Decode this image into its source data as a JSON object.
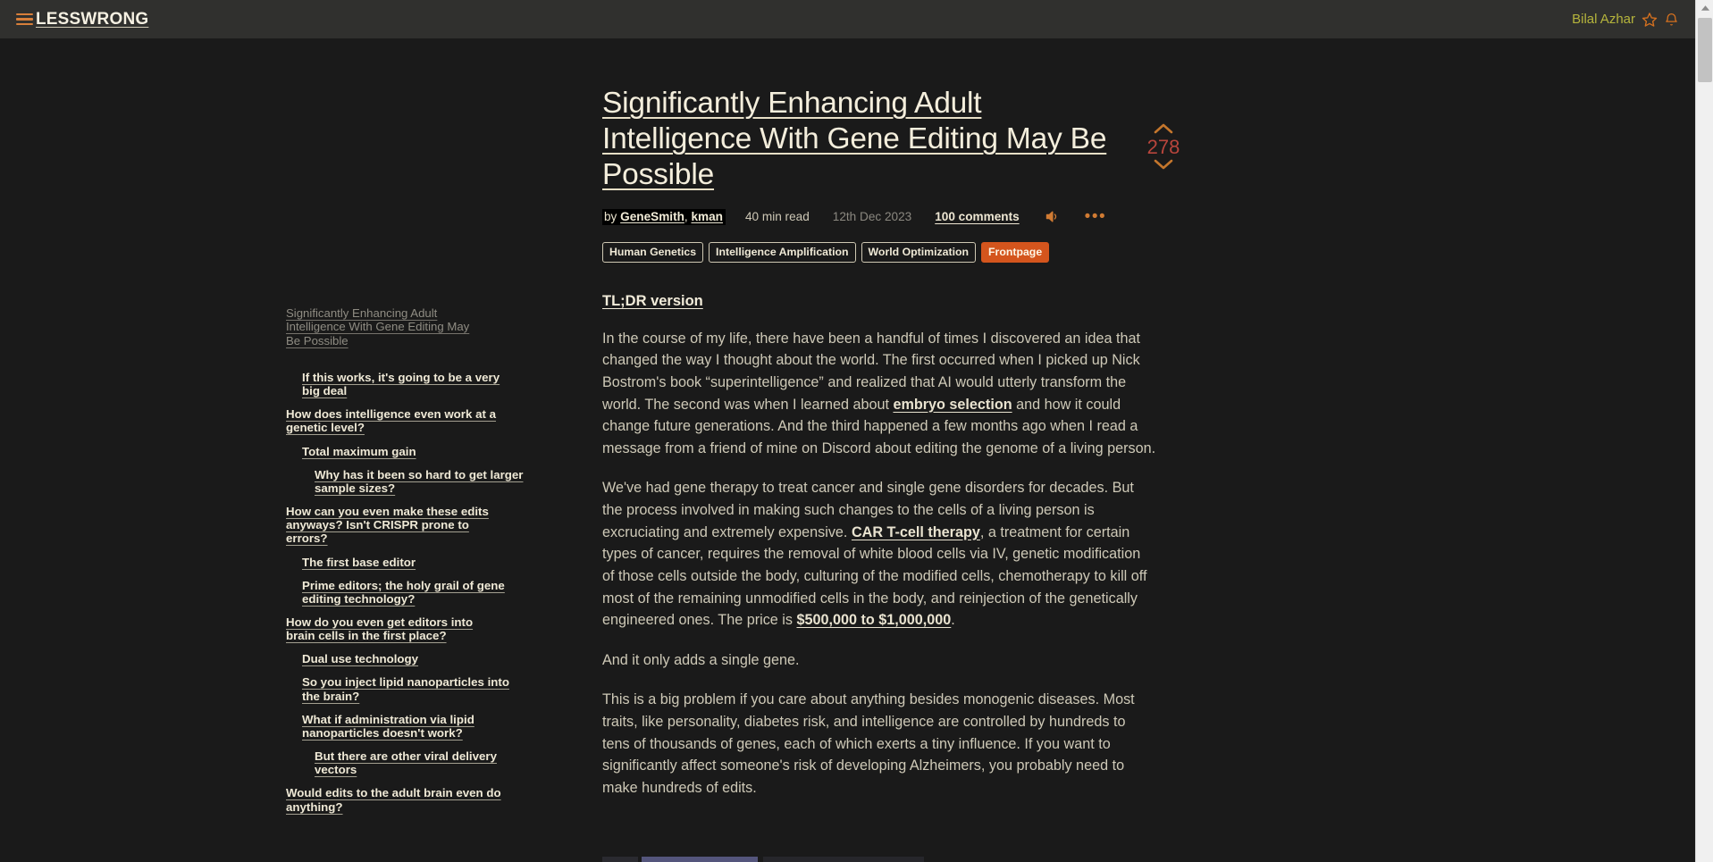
{
  "header": {
    "menu_icon": "hamburger-icon",
    "brand": "LESSWRONG",
    "username": "Bilal Azhar",
    "star_icon": "star-icon",
    "bell_icon": "bell-icon"
  },
  "sidebar": {
    "title_entry": "Significantly Enhancing Adult Intelligence With Gene Editing May Be Possible",
    "items": [
      {
        "label": "If this works, it's going to be a very big deal",
        "level": 1
      },
      {
        "label": "How does intelligence even work at a genetic level?",
        "level": 0
      },
      {
        "label": "Total maximum gain",
        "level": 1
      },
      {
        "label": "Why has it been so hard to get larger sample sizes?",
        "level": 2
      },
      {
        "label": "How can you even make these edits anyways? Isn't CRISPR prone to errors?",
        "level": 0
      },
      {
        "label": "The first base editor",
        "level": 1
      },
      {
        "label": "Prime editors; the holy grail of gene editing technology?",
        "level": 1
      },
      {
        "label": "How do you even get editors into brain cells in the first place?",
        "level": 0
      },
      {
        "label": "Dual use technology",
        "level": 1
      },
      {
        "label": "So you inject lipid nanoparticles into the brain?",
        "level": 1
      },
      {
        "label": "What if administration via lipid nanoparticles doesn't work?",
        "level": 1
      },
      {
        "label": "But there are other viral delivery vectors",
        "level": 2
      },
      {
        "label": "Would edits to the adult brain even do anything?",
        "level": 0
      }
    ]
  },
  "post": {
    "title": "Significantly Enhancing Adult Intelligence With Gene Editing May Be Possible",
    "vote": {
      "upvote_icon": "chevron-up-icon",
      "count": "278",
      "downvote_icon": "chevron-down-icon"
    },
    "byline": {
      "by_prefix": "by ",
      "author_1": "GeneSmith",
      "author_separator": ", ",
      "author_2": "kman",
      "read_time": "40 min read",
      "date": "12th Dec 2023",
      "comments": "100 comments",
      "audio_icon": "speaker-icon",
      "more_icon": "ellipsis-icon"
    },
    "tags": [
      {
        "label": "Human Genetics",
        "highlighted": false
      },
      {
        "label": "Intelligence Amplification",
        "highlighted": false
      },
      {
        "label": "World Optimization",
        "highlighted": false
      },
      {
        "label": "Frontpage",
        "highlighted": true
      }
    ],
    "section_heading": "TL;DR version",
    "paragraph_1_a": "In the course of my life, there have been a handful of times I discovered an idea that changed the way I thought about the world. The first occurred when I picked up Nick Bostrom's book “superintelligence” and realized that AI would utterly transform the world. The second was when I learned about ",
    "paragraph_1_link": "embryo selection",
    "paragraph_1_b": " and how it could change future generations. And the third happened a few months ago when I read a message from a friend of mine on Discord about editing the genome of a living person.",
    "paragraph_2_a": "We've had gene therapy to treat cancer and single gene disorders for decades. But the process involved in making such changes to the cells of a living person is excruciating and extremely expensive. ",
    "paragraph_2_link_1": "CAR T-cell therapy",
    "paragraph_2_b": ", a treatment for certain types of cancer, requires the removal of white blood cells via IV, genetic modification of those cells outside the body, culturing of the modified cells, chemotherapy to kill off most of the remaining unmodified cells in the body, and reinjection of the genetically engineered ones. The price is  ",
    "paragraph_2_link_2": "$500,000 to $1,000,000",
    "paragraph_2_c": ".",
    "paragraph_3": "And it only adds a single gene.",
    "paragraph_4": "This is a big problem if you care about anything besides monogenic diseases. Most traits, like personality, diabetes risk, and intelligence are controlled by hundreds to tens of thousands of genes, each of which exerts a tiny influence. If you want to significantly affect someone's risk of developing Alzheimers, you probably need to make hundreds of edits."
  },
  "scrollbar": {
    "up_arrow_icon": "scroll-up-arrow-icon",
    "thumb": "scroll-thumb"
  },
  "colors": {
    "header_bg": "#30302e",
    "page_bg": "#1a1a1a",
    "accent_orange": "#d4551d",
    "link_cream": "#f2ecda",
    "body_text": "#cec9b7",
    "vote_red": "#b8453c",
    "username_olive": "#b5b43c"
  }
}
